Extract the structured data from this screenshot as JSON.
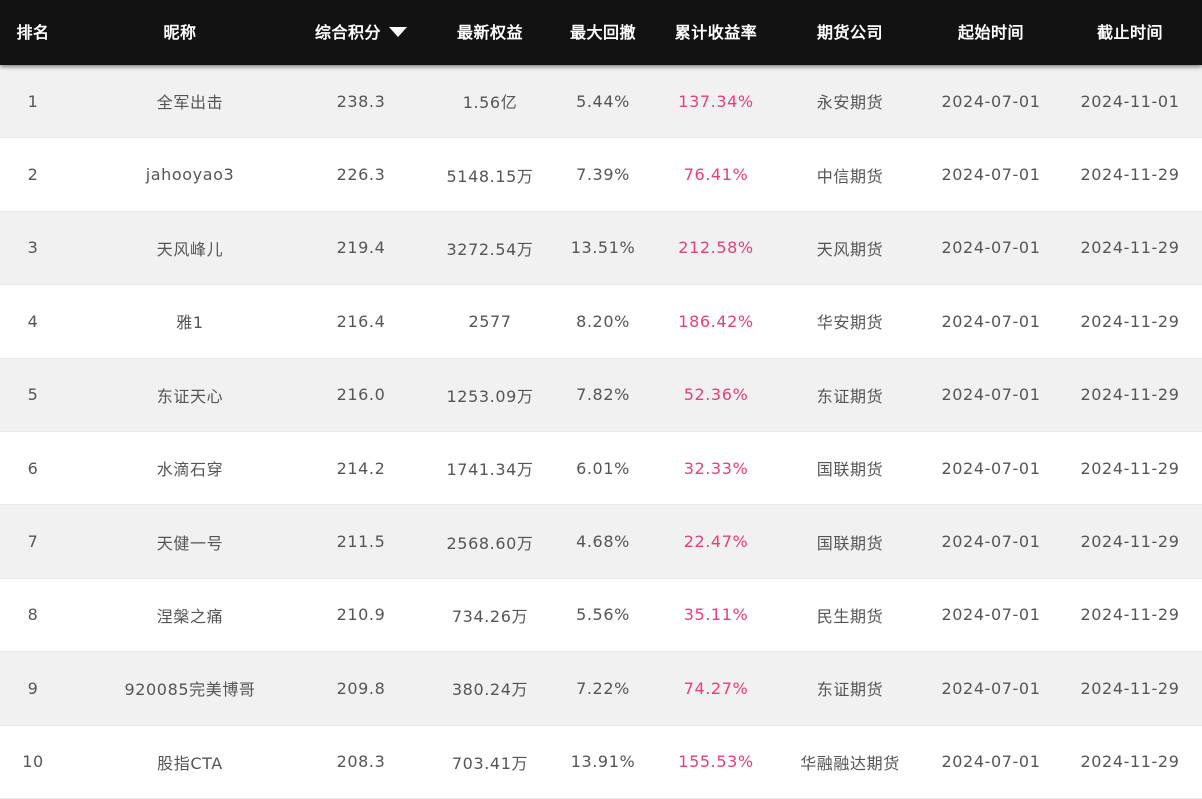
{
  "table": {
    "headers": {
      "rank": "排名",
      "nickname": "昵称",
      "score": "综合积分",
      "equity": "最新权益",
      "drawdown": "最大回撤",
      "return": "累计收益率",
      "company": "期货公司",
      "start": "起始时间",
      "end": "截止时间"
    },
    "sort_icon": "sort-desc-triangle-icon",
    "colors": {
      "header_bg": "#121212",
      "header_text": "#ffffff",
      "row_alt_bg": "#f1f1f1",
      "row_bg": "#ffffff",
      "text": "#555555",
      "return_text": "#e83e7c"
    },
    "rows": [
      {
        "rank": "1",
        "nickname": "全军出击",
        "score": "238.3",
        "equity": "1.56亿",
        "drawdown": "5.44%",
        "return": "137.34%",
        "company": "永安期货",
        "start": "2024-07-01",
        "end": "2024-11-01"
      },
      {
        "rank": "2",
        "nickname": "jahooyao3",
        "score": "226.3",
        "equity": "5148.15万",
        "drawdown": "7.39%",
        "return": "76.41%",
        "company": "中信期货",
        "start": "2024-07-01",
        "end": "2024-11-29"
      },
      {
        "rank": "3",
        "nickname": "天风峰儿",
        "score": "219.4",
        "equity": "3272.54万",
        "drawdown": "13.51%",
        "return": "212.58%",
        "company": "天风期货",
        "start": "2024-07-01",
        "end": "2024-11-29"
      },
      {
        "rank": "4",
        "nickname": "雅1",
        "score": "216.4",
        "equity": "2577",
        "drawdown": "8.20%",
        "return": "186.42%",
        "company": "华安期货",
        "start": "2024-07-01",
        "end": "2024-11-29"
      },
      {
        "rank": "5",
        "nickname": "东证天心",
        "score": "216.0",
        "equity": "1253.09万",
        "drawdown": "7.82%",
        "return": "52.36%",
        "company": "东证期货",
        "start": "2024-07-01",
        "end": "2024-11-29"
      },
      {
        "rank": "6",
        "nickname": "水滴石穿",
        "score": "214.2",
        "equity": "1741.34万",
        "drawdown": "6.01%",
        "return": "32.33%",
        "company": "国联期货",
        "start": "2024-07-01",
        "end": "2024-11-29"
      },
      {
        "rank": "7",
        "nickname": "天健一号",
        "score": "211.5",
        "equity": "2568.60万",
        "drawdown": "4.68%",
        "return": "22.47%",
        "company": "国联期货",
        "start": "2024-07-01",
        "end": "2024-11-29"
      },
      {
        "rank": "8",
        "nickname": "涅槃之痛",
        "score": "210.9",
        "equity": "734.26万",
        "drawdown": "5.56%",
        "return": "35.11%",
        "company": "民生期货",
        "start": "2024-07-01",
        "end": "2024-11-29"
      },
      {
        "rank": "9",
        "nickname": "920085完美博哥",
        "score": "209.8",
        "equity": "380.24万",
        "drawdown": "7.22%",
        "return": "74.27%",
        "company": "东证期货",
        "start": "2024-07-01",
        "end": "2024-11-29"
      },
      {
        "rank": "10",
        "nickname": "股指CTA",
        "score": "208.3",
        "equity": "703.41万",
        "drawdown": "13.91%",
        "return": "155.53%",
        "company": "华融融达期货",
        "start": "2024-07-01",
        "end": "2024-11-29"
      }
    ]
  }
}
